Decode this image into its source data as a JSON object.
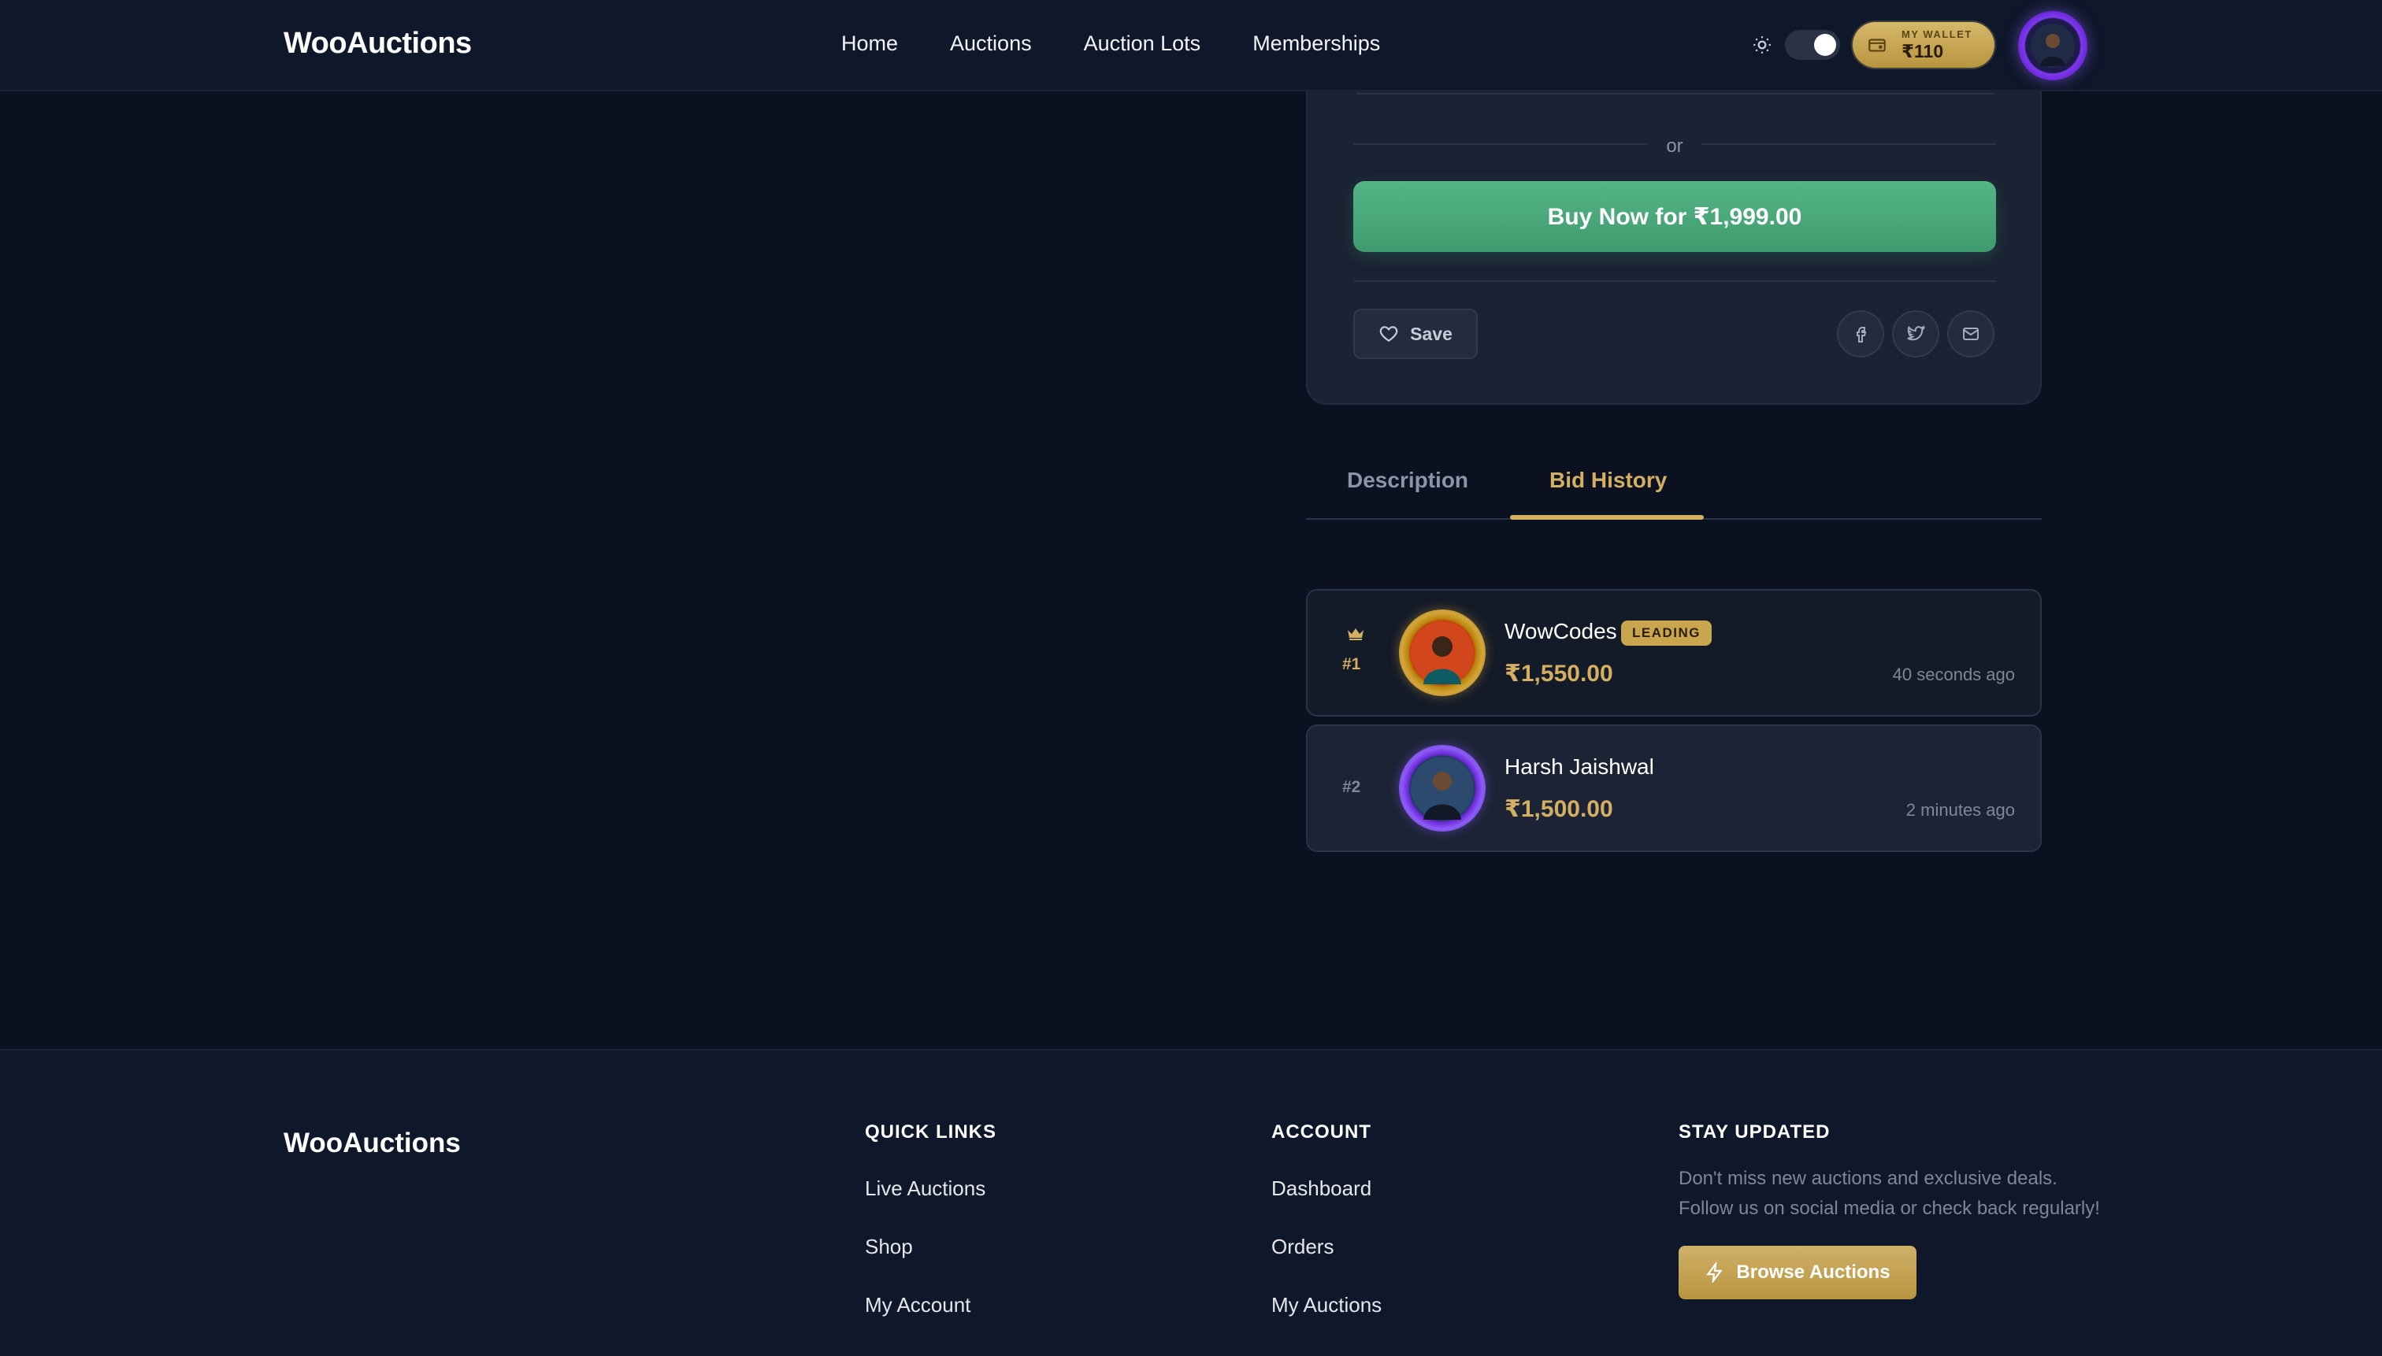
{
  "header": {
    "logo": "WooAuctions",
    "nav": [
      "Home",
      "Auctions",
      "Auction Lots",
      "Memberships"
    ],
    "wallet": {
      "label": "MY WALLET",
      "amount": "₹110"
    },
    "theme_toggle": {
      "state": "on",
      "icon": "sun-icon"
    }
  },
  "purchase_card": {
    "divider_text": "or",
    "buy_now_label": "Buy Now for ₹1,999.00",
    "save_label": "Save",
    "share_icons": [
      "facebook-icon",
      "twitter-icon",
      "mail-icon"
    ]
  },
  "tabs": {
    "items": [
      "Description",
      "Bid History"
    ],
    "active": "Bid History"
  },
  "bids": [
    {
      "rank": "#1",
      "name": "WowCodes",
      "badge": "LEADING",
      "amount": "₹1,550.00",
      "time": "40 seconds ago"
    },
    {
      "rank": "#2",
      "name": "Harsh Jaishwal",
      "amount": "₹1,500.00",
      "time": "2 minutes ago"
    }
  ],
  "footer": {
    "logo": "WooAuctions",
    "quick_links": {
      "heading": "QUICK LINKS",
      "items": [
        "Live Auctions",
        "Shop",
        "My Account"
      ]
    },
    "account": {
      "heading": "ACCOUNT",
      "items": [
        "Dashboard",
        "Orders",
        "My Auctions"
      ]
    },
    "stay_updated": {
      "heading": "STAY UPDATED",
      "text": "Don't miss new auctions and exclusive deals. Follow us on social media or check back regularly!",
      "button_label": "Browse Auctions"
    }
  },
  "colors": {
    "background": "#0b1120",
    "accent_gold": "#d4af62",
    "buy_green": "#4caa7c",
    "card": "#1a2233"
  }
}
